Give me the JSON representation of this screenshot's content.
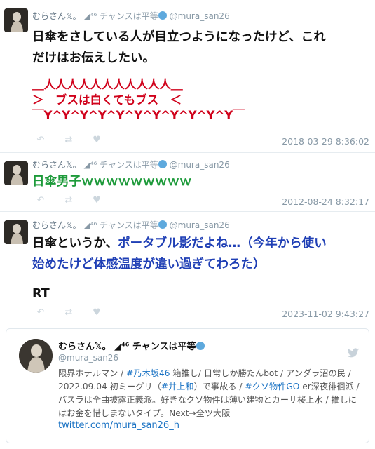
{
  "tweets": [
    {
      "display_name": "むらさん𝕏。",
      "display_suffix": "◢⁴⁶ チャンスは平等",
      "handle": "@mura_san26",
      "line1": "日傘をさしている人が目立つようになったけど、これ",
      "line2": "だけはお伝えしたい。",
      "ascii_top": "＿人人人人人人人人人人人＿",
      "ascii_mid": "＞　ブスは白くてもブス　＜",
      "ascii_bottom": "￣Y^Y^Y^Y^Y^Y^Y^Y^Y^Y^Y￣",
      "timestamp": "2018-03-29 8:36:02"
    },
    {
      "display_name": "むらさん𝕏。",
      "display_suffix": "◢⁴⁶ チャンスは平等",
      "handle": "@mura_san26",
      "text": "日傘男子ｗｗｗｗｗｗｗｗｗ",
      "timestamp": "2012-08-24 8:32:17"
    },
    {
      "display_name": "むらさん𝕏。",
      "display_suffix": "◢⁴⁶ チャンスは平等",
      "handle": "@mura_san26",
      "line1_plain": "日傘というか、",
      "line1_blue": "ポータブル影だよね…（今年から使い",
      "line2_blue": "始めたけど体感温度が違い過ぎてわろた）",
      "rt": "RT",
      "timestamp": "2023-11-02 9:43:27"
    }
  ],
  "profile_card": {
    "display_name": "むらさん𝕏。",
    "display_suffix": "◢⁴⁶ チャンスは平等",
    "handle": "@mura_san26",
    "bio_line1_a": "限界ホテルマン / ",
    "bio_line1_tag": "#乃木坂46",
    "bio_line1_b": " 箱推し/ 日常しか勝たんbot / アンダラ沼の民 /",
    "bio_line2_a": "2022.09.04 初ミーグリ（",
    "bio_line2_tag": "#井上和",
    "bio_line2_b": "）で事故る / ",
    "bio_line2_tag2": "#クソ物件GO",
    "bio_line2_c": " er深夜徘徊派 /",
    "bio_line3": "バスラは全曲披露正義派。好きなクソ物件は薄い建物とカーサ桜上水 / 推しに",
    "bio_line4": "はお金を惜しまないタイプ。Next→全ツ大阪",
    "link": "twitter.com/mura_san26_h"
  },
  "icons": [
    "reply-icon",
    "retweet-icon",
    "like-icon",
    "verified-icon",
    "twitter-bird-icon"
  ],
  "colors": {
    "red": "#d0021b",
    "green": "#1d9a3a",
    "blue": "#1f3fb5",
    "link": "#1b73c4"
  }
}
